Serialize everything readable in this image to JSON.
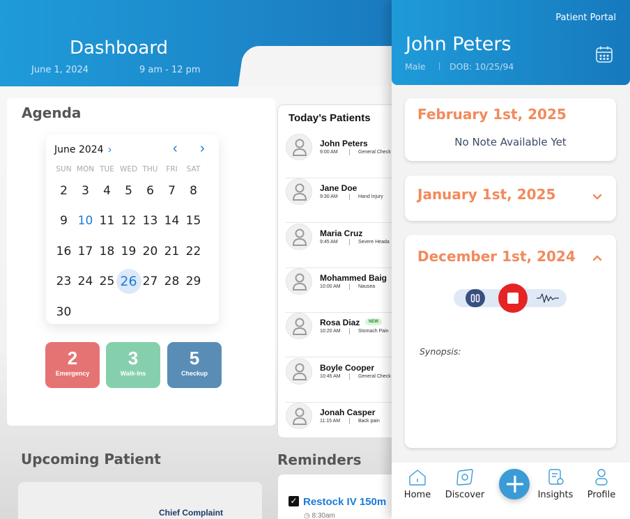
{
  "dashboard": {
    "title": "Dashboard",
    "date": "June 1, 2024",
    "time_range": "9 am - 12 pm"
  },
  "agenda": {
    "title": "Agenda",
    "calendar": {
      "month_label": "June 2024",
      "weekdays": [
        "SUN",
        "MON",
        "TUE",
        "WED",
        "THU",
        "FRI",
        "SAT"
      ],
      "weeks": [
        [
          "",
          "",
          "",
          "",
          "",
          "",
          ""
        ],
        [
          "2",
          "3",
          "4",
          "5",
          "6",
          "7",
          "8"
        ],
        [
          "9",
          "10",
          "11",
          "12",
          "13",
          "14",
          "15"
        ],
        [
          "16",
          "17",
          "18",
          "19",
          "20",
          "21",
          "22"
        ],
        [
          "23",
          "24",
          "25",
          "26",
          "27",
          "28",
          "29"
        ],
        [
          "30",
          "",
          "",
          "",
          "",
          "",
          ""
        ]
      ],
      "today": "10",
      "selected": "26"
    },
    "stats": [
      {
        "value": "2",
        "label": "Emergency",
        "color": "#e57373"
      },
      {
        "value": "3",
        "label": "Walk-Ins",
        "color": "#86cfad"
      },
      {
        "value": "5",
        "label": "Checkup",
        "color": "#5a8db5"
      }
    ]
  },
  "todays_patients": {
    "title": "Today’s Patients",
    "patients": [
      {
        "name": "John Peters",
        "time": "9:00 AM",
        "reason": "General Check",
        "badge": ""
      },
      {
        "name": "Jane Doe",
        "time": "9:30 AM",
        "reason": "Hand Injury",
        "badge": ""
      },
      {
        "name": "Maria Cruz",
        "time": "9:45 AM",
        "reason": "Severe Heada",
        "badge": ""
      },
      {
        "name": "Mohammed Baig",
        "time": "10:00 AM",
        "reason": "Nausea",
        "badge": ""
      },
      {
        "name": "Rosa Diaz",
        "time": "10:20 AM",
        "reason": "Stomach Pain",
        "badge": "NEW"
      },
      {
        "name": "Boyle Cooper",
        "time": "10:45 AM",
        "reason": "General Check",
        "badge": ""
      },
      {
        "name": "Jonah Casper",
        "time": "11:15 AM",
        "reason": "Back pain",
        "badge": ""
      }
    ]
  },
  "upcoming": {
    "title": "Upcoming Patient",
    "chief_complaint_label": "Chief Complaint"
  },
  "reminders": {
    "title": "Reminders",
    "items": [
      {
        "text": "Restock IV 150m",
        "time": "8:30am",
        "checked": true
      }
    ]
  },
  "patient_portal": {
    "label": "Patient Portal",
    "patient_name": "John Peters",
    "sex": "Male",
    "dob": "DOB: 10/25/94",
    "notes": [
      {
        "date": "February 1st, 2025",
        "content": "No Note Available Yet",
        "state": "open-empty"
      },
      {
        "date": "January 1st, 2025",
        "state": "collapsed"
      },
      {
        "date": "December 1st, 2024",
        "state": "expanded",
        "synopsis_label": "Synopsis:"
      }
    ],
    "nav": [
      {
        "label": "Home",
        "icon": "home-icon"
      },
      {
        "label": "Discover",
        "icon": "compass-icon"
      },
      {
        "label": "Insights",
        "icon": "document-chart-icon"
      },
      {
        "label": "Profile",
        "icon": "profile-icon"
      }
    ],
    "accent_color": "#f28a5b",
    "brand_color": "#1a7cc0"
  }
}
